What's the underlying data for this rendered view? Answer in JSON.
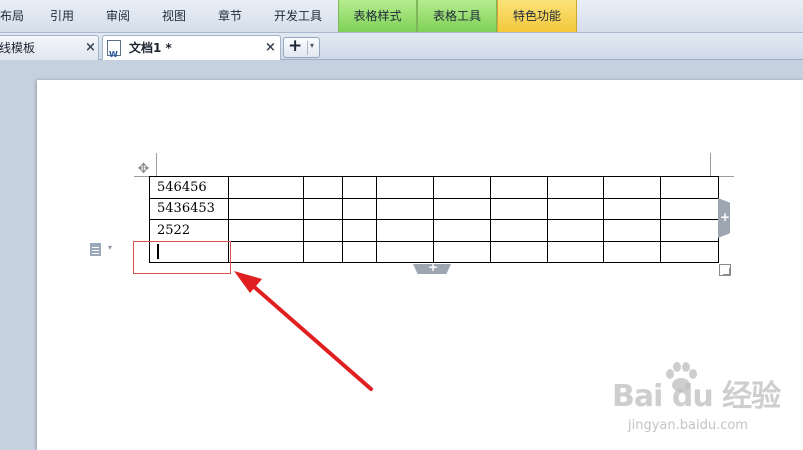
{
  "ribbon": {
    "tabs": [
      {
        "label": "布局",
        "style": "normal"
      },
      {
        "label": "引用",
        "style": "normal"
      },
      {
        "label": "审阅",
        "style": "normal"
      },
      {
        "label": "视图",
        "style": "normal"
      },
      {
        "label": "章节",
        "style": "normal"
      },
      {
        "label": "开发工具",
        "style": "normal"
      },
      {
        "label": "表格样式",
        "style": "green"
      },
      {
        "label": "表格工具",
        "style": "green"
      },
      {
        "label": "特色功能",
        "style": "yellow"
      }
    ]
  },
  "doc_tabs": {
    "tabs": [
      {
        "label": "在线模板",
        "active": false
      },
      {
        "label": "文档1 *",
        "active": true
      }
    ],
    "close_glyph": "×",
    "new_tab_glyph": "+",
    "dropdown_glyph": "▾"
  },
  "table": {
    "rows": [
      [
        "546456",
        "",
        "",
        "",
        "",
        "",
        "",
        "",
        "",
        ""
      ],
      [
        "5436453",
        "",
        "",
        "",
        "",
        "",
        "",
        "",
        "",
        ""
      ],
      [
        "2522",
        "",
        "",
        "",
        "",
        "",
        "",
        "",
        "",
        ""
      ],
      [
        "",
        "",
        "",
        "",
        "",
        "",
        "",
        "",
        "",
        ""
      ]
    ],
    "cursor_cell": [
      3,
      0
    ]
  },
  "handles": {
    "move_glyph": "✥",
    "add_glyph": "+"
  },
  "watermark": {
    "brand": "Bai du 经验",
    "url": "jingyan.baidu.com"
  },
  "colors": {
    "green_tab": "#8fdc62",
    "yellow_tab": "#f5cf45",
    "annotation": "#d9534f"
  }
}
